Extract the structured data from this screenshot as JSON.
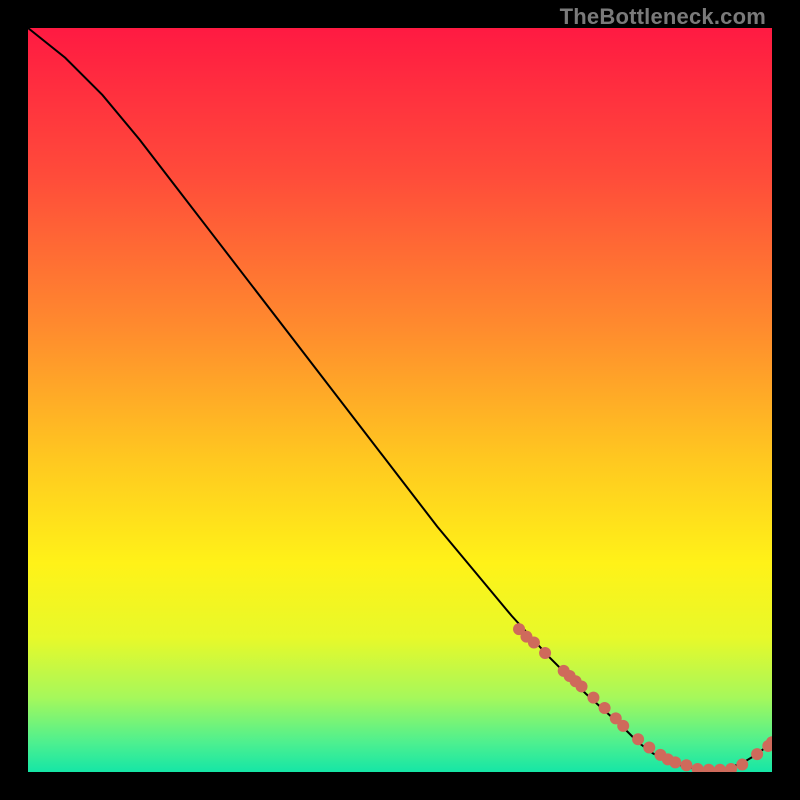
{
  "watermark": "TheBottleneck.com",
  "chart_data": {
    "type": "line",
    "title": "",
    "xlabel": "",
    "ylabel": "",
    "xlim": [
      0,
      100
    ],
    "ylim": [
      0,
      100
    ],
    "grid": false,
    "legend": false,
    "series": [
      {
        "name": "curve",
        "style": "line",
        "color": "#000000",
        "x": [
          0,
          5,
          10,
          15,
          20,
          25,
          30,
          35,
          40,
          45,
          50,
          55,
          60,
          65,
          70,
          75,
          80,
          82,
          84,
          86,
          88,
          90,
          92,
          94,
          96,
          98,
          100
        ],
        "y": [
          100,
          96,
          91,
          85,
          78.5,
          72,
          65.5,
          59,
          52.5,
          46,
          39.5,
          33,
          27,
          21,
          15.5,
          10.5,
          6,
          4,
          2.5,
          1.5,
          0.8,
          0.4,
          0.3,
          0.5,
          1.2,
          2.4,
          4
        ]
      },
      {
        "name": "bottleneck-markers",
        "style": "scatter",
        "color": "#cf6a5b",
        "x": [
          66,
          67,
          68,
          69.5,
          72,
          72.8,
          73.6,
          74.4,
          76,
          77.5,
          79,
          80,
          82,
          83.5,
          85,
          86,
          87,
          88.5,
          90,
          91.5,
          93,
          94.5,
          96,
          98,
          99.5,
          100
        ],
        "y": [
          19.2,
          18.2,
          17.4,
          16.0,
          13.6,
          12.9,
          12.2,
          11.5,
          10.0,
          8.6,
          7.2,
          6.2,
          4.4,
          3.3,
          2.3,
          1.7,
          1.3,
          0.9,
          0.4,
          0.3,
          0.3,
          0.4,
          1.0,
          2.4,
          3.5,
          4.0
        ]
      }
    ],
    "background_gradient": {
      "type": "vertical",
      "stops": [
        {
          "pos": 0.0,
          "color": "#ff1a42"
        },
        {
          "pos": 0.2,
          "color": "#ff4c3a"
        },
        {
          "pos": 0.4,
          "color": "#ff8a2e"
        },
        {
          "pos": 0.58,
          "color": "#ffc820"
        },
        {
          "pos": 0.72,
          "color": "#fff218"
        },
        {
          "pos": 0.82,
          "color": "#e7f92a"
        },
        {
          "pos": 0.9,
          "color": "#a6f85b"
        },
        {
          "pos": 0.96,
          "color": "#4ef08f"
        },
        {
          "pos": 1.0,
          "color": "#15e6a6"
        }
      ]
    }
  }
}
